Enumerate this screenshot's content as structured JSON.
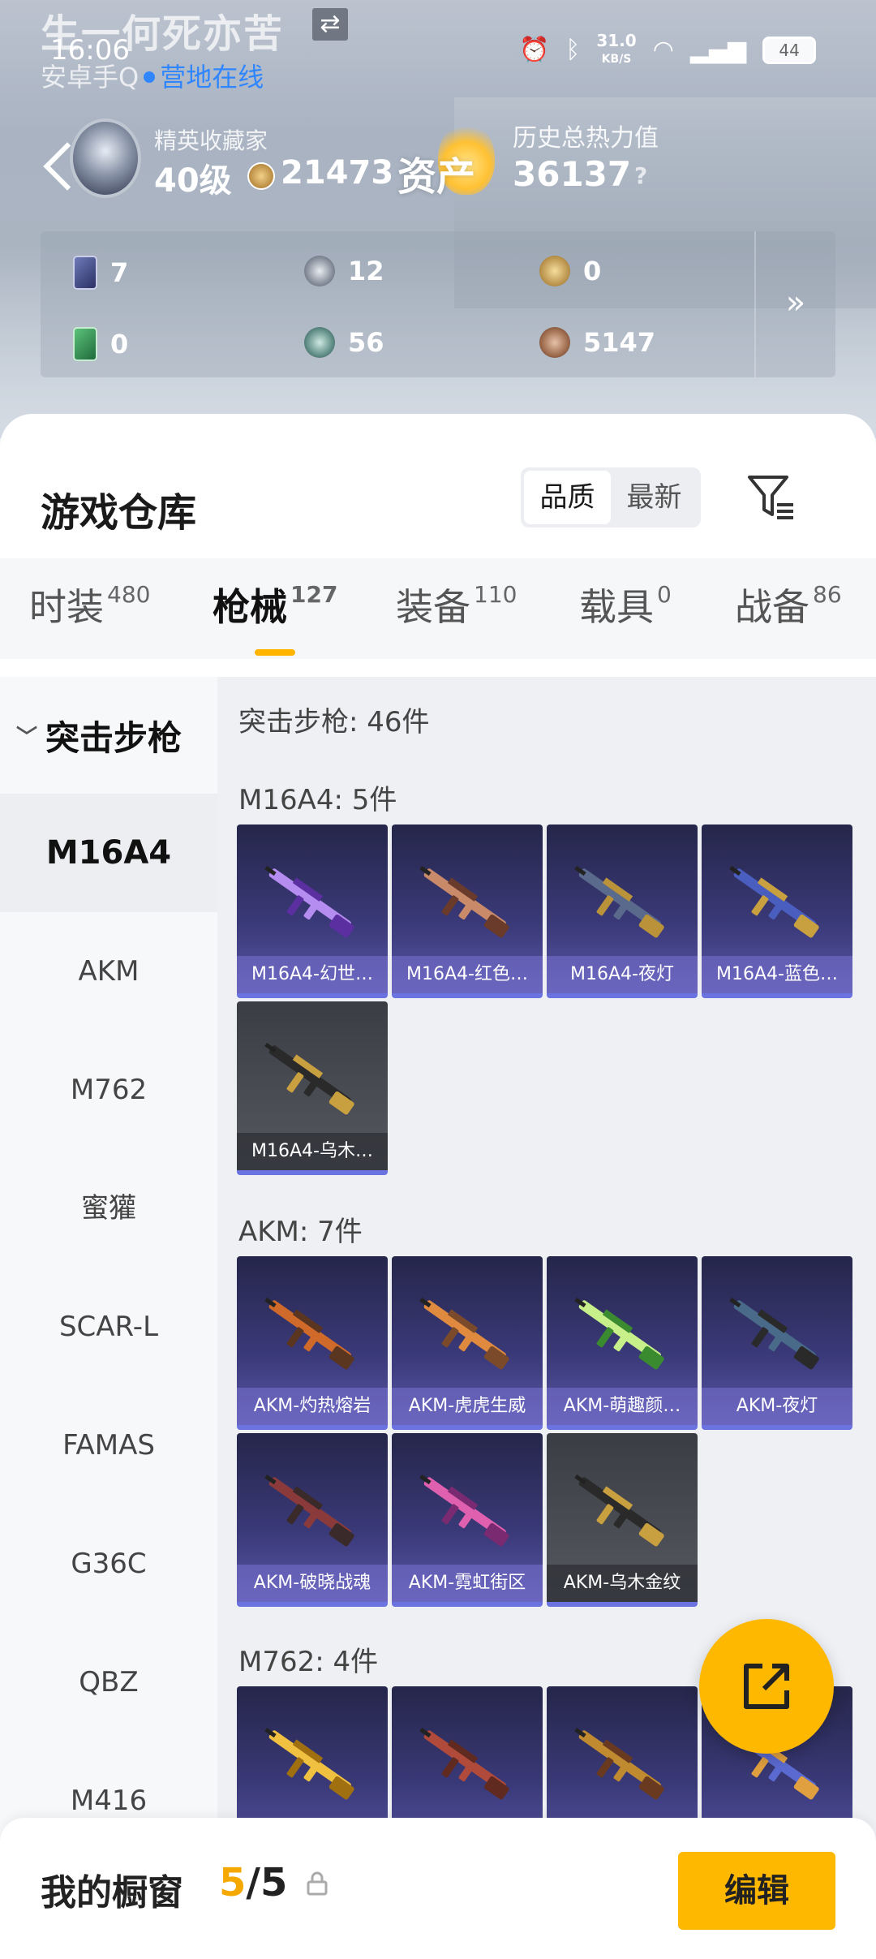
{
  "header": {
    "user_name": "生一何死亦苦",
    "time": "16:06",
    "platform": "安卓手Q",
    "online": "营地在线",
    "net_speed": "31.0",
    "net_unit": "KB/S",
    "battery": "44",
    "rank_title": "精英收藏家",
    "rank_level": "40级",
    "coins": "21473",
    "asset_label": "资产",
    "heat_title": "历史总热力值",
    "heat_value": "36137",
    "help": "?",
    "more": "»"
  },
  "stats": [
    {
      "value": "7",
      "icon": "card-blue-icon"
    },
    {
      "value": "12",
      "icon": "silver-medal-icon"
    },
    {
      "value": "0",
      "icon": "gold-medal-icon"
    },
    {
      "value": "0",
      "icon": "card-green-icon"
    },
    {
      "value": "56",
      "icon": "teal-medal-icon"
    },
    {
      "value": "5147",
      "icon": "bronze-medal-icon"
    }
  ],
  "panel": {
    "title": "游戏仓库",
    "sort_quality": "品质",
    "sort_newest": "最新"
  },
  "tabs": [
    {
      "label": "时装",
      "count": "480"
    },
    {
      "label": "枪械",
      "count": "127"
    },
    {
      "label": "装备",
      "count": "110"
    },
    {
      "label": "载具",
      "count": "0"
    },
    {
      "label": "战备",
      "count": "86"
    }
  ],
  "sidebar": {
    "category": "突击步枪",
    "items": [
      "M16A4",
      "AKM",
      "M762",
      "蜜獾",
      "SCAR-L",
      "FAMAS",
      "G36C",
      "QBZ",
      "M416"
    ]
  },
  "content": {
    "section_title": "突击步枪: 46件",
    "groups": [
      {
        "title": "M16A4: 5件",
        "items": [
          "M16A4-幻世…",
          "M16A4-红色…",
          "M16A4-夜灯",
          "M16A4-蓝色…",
          "M16A4-乌木…"
        ]
      },
      {
        "title": "AKM: 7件",
        "items": [
          "AKM-灼热熔岩",
          "AKM-虎虎生威",
          "AKM-萌趣颜…",
          "AKM-夜灯",
          "AKM-破晓战魂",
          "AKM-霓虹街区",
          "AKM-乌木金纹"
        ]
      },
      {
        "title": "M762: 4件",
        "items": [
          "",
          "",
          "",
          ""
        ]
      }
    ]
  },
  "bottom": {
    "title": "我的橱窗",
    "current": "5",
    "sep": "/",
    "total": "5",
    "edit": "编辑"
  },
  "colors": {
    "accent": "#ffb800",
    "link_blue": "#2f86ff",
    "tile_purple": "#3b3a7a",
    "tile_grey": "#4a4c53"
  }
}
